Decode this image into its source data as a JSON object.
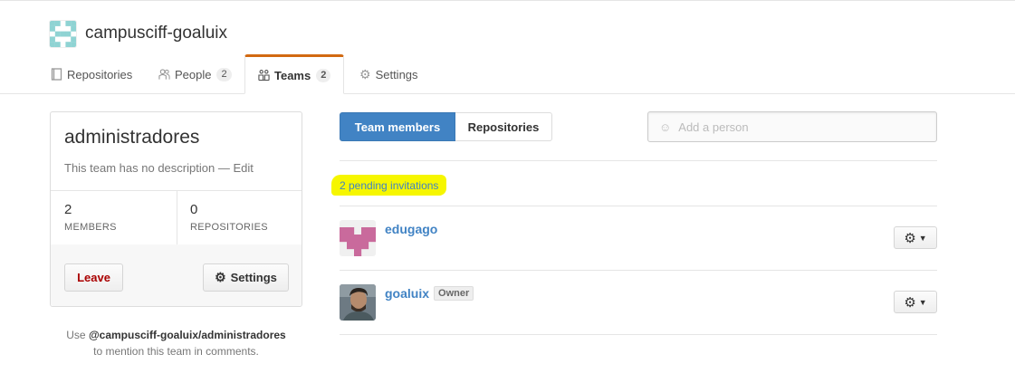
{
  "org": {
    "name": "campusciff-goaluix"
  },
  "tabs": [
    {
      "label": "Repositories",
      "icon": "repo-icon"
    },
    {
      "label": "People",
      "icon": "people-icon",
      "count": "2"
    },
    {
      "label": "Teams",
      "icon": "teams-icon",
      "count": "2",
      "selected": true
    },
    {
      "label": "Settings",
      "icon": "gear-icon"
    }
  ],
  "team": {
    "name": "administradores",
    "description": "This team has no description",
    "description_sep": " — ",
    "edit_label": "Edit",
    "members_count": "2",
    "members_label": "MEMBERS",
    "repos_count": "0",
    "repos_label": "REPOSITORIES",
    "leave_label": "Leave",
    "settings_label": "Settings"
  },
  "mention": {
    "prefix": "Use ",
    "handle": "@campusciff-goaluix/administradores",
    "suffix": "to mention this team in comments."
  },
  "main": {
    "tab_members": "Team members",
    "tab_repos": "Repositories",
    "add_placeholder": "Add a person",
    "pending_label": "2 pending invitations",
    "members": [
      {
        "name": "edugago",
        "badge": ""
      },
      {
        "name": "goaluix",
        "badge": "Owner"
      }
    ]
  },
  "colors": {
    "accent": "#4183c4",
    "tab_highlight": "#d26911",
    "highlight_marker": "#f6f600",
    "leave_red": "#aa0000",
    "identicon_org": "#8fd3d3",
    "identicon_edugago": "#c96a9c"
  }
}
